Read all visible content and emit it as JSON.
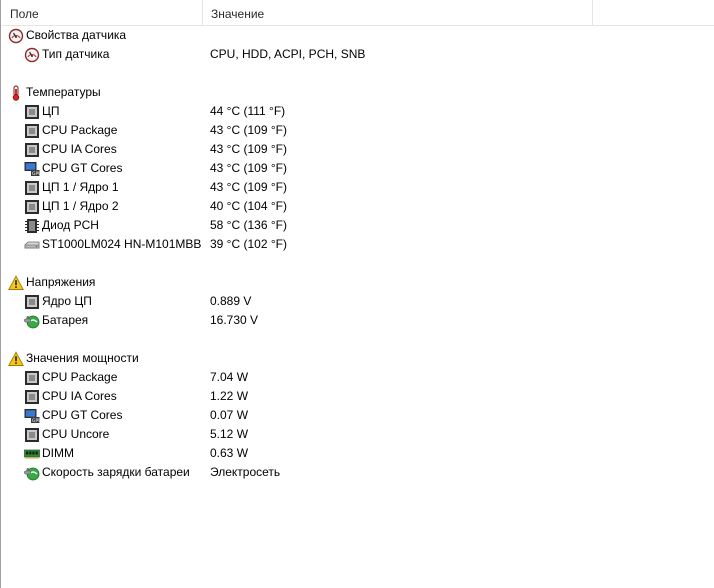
{
  "header": {
    "field": "Поле",
    "value": "Значение"
  },
  "groups": [
    {
      "title": "Свойства датчика",
      "icon": "gauge-icon",
      "items": [
        {
          "label": "Тип датчика",
          "value": "CPU, HDD, ACPI, PCH, SNB",
          "icon": "gauge-icon"
        }
      ]
    },
    {
      "title": "Температуры",
      "icon": "thermometer-icon",
      "items": [
        {
          "label": "ЦП",
          "value": "44 °C  (111 °F)",
          "icon": "cpu-chip-icon"
        },
        {
          "label": "CPU Package",
          "value": "43 °C  (109 °F)",
          "icon": "cpu-chip-icon"
        },
        {
          "label": "CPU IA Cores",
          "value": "43 °C  (109 °F)",
          "icon": "cpu-chip-icon"
        },
        {
          "label": "CPU GT Cores",
          "value": "43 °C  (109 °F)",
          "icon": "gpu-monitor-icon"
        },
        {
          "label": "ЦП 1 / Ядро 1",
          "value": "43 °C  (109 °F)",
          "icon": "cpu-chip-icon"
        },
        {
          "label": "ЦП 1 / Ядро 2",
          "value": "40 °C  (104 °F)",
          "icon": "cpu-chip-icon"
        },
        {
          "label": "Диод PCH",
          "value": "58 °C  (136 °F)",
          "icon": "chipset-icon"
        },
        {
          "label": "ST1000LM024 HN-M101MBB",
          "value": "39 °C  (102 °F)",
          "icon": "hard-drive-icon"
        }
      ]
    },
    {
      "title": "Напряжения",
      "icon": "warning-icon",
      "items": [
        {
          "label": "Ядро ЦП",
          "value": "0.889 V",
          "icon": "cpu-chip-icon"
        },
        {
          "label": "Батарея",
          "value": "16.730 V",
          "icon": "battery-power-icon"
        }
      ]
    },
    {
      "title": "Значения мощности",
      "icon": "warning-icon",
      "items": [
        {
          "label": "CPU Package",
          "value": "7.04 W",
          "icon": "cpu-chip-icon"
        },
        {
          "label": "CPU IA Cores",
          "value": "1.22 W",
          "icon": "cpu-chip-icon"
        },
        {
          "label": "CPU GT Cores",
          "value": "0.07 W",
          "icon": "gpu-monitor-icon"
        },
        {
          "label": "CPU Uncore",
          "value": "5.12 W",
          "icon": "cpu-chip-icon"
        },
        {
          "label": "DIMM",
          "value": "0.63 W",
          "icon": "memory-module-icon"
        },
        {
          "label": "Скорость зарядки батареи",
          "value": "Электросеть",
          "icon": "battery-power-icon"
        }
      ]
    }
  ]
}
